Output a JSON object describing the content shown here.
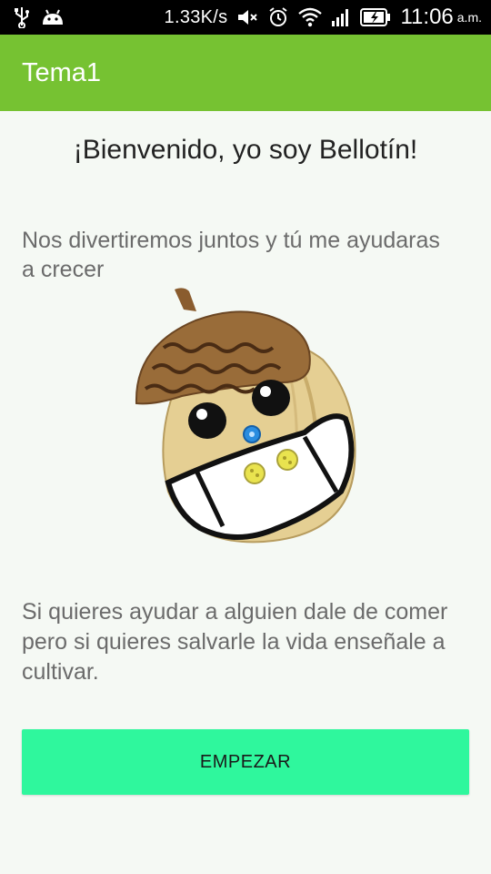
{
  "status_bar": {
    "net_speed": "1.33K/s",
    "time": "11:06",
    "ampm": "a.m.",
    "icons": [
      "usb-icon",
      "android-icon",
      "mute-icon",
      "alarm-icon",
      "wifi-icon",
      "signal-icon",
      "battery-charging-icon"
    ]
  },
  "app_bar": {
    "title": "Tema1",
    "color": "#76c232"
  },
  "main": {
    "welcome": "¡Bienvenido, yo soy Bellotín!",
    "intro": "Nos divertiremos juntos y tú me ayudaras a crecer",
    "mascot_icon": "acorn-mascot",
    "quote": "Si quieres ayudar a alguien  dale de comer pero si quieres  salvarle la vida enseñale a  cultivar.",
    "start_button": "EMPEZAR",
    "button_color": "#2ff79d"
  }
}
